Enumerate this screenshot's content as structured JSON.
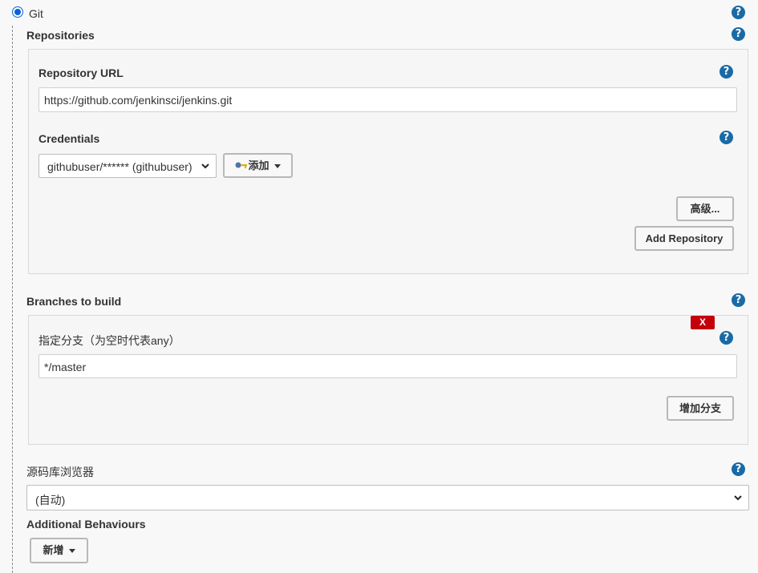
{
  "scm": {
    "git_label": "Git",
    "selected": true
  },
  "repositories": {
    "section_label": "Repositories",
    "url_label": "Repository URL",
    "url_value": "https://github.com/jenkinsci/jenkins.git",
    "credentials_label": "Credentials",
    "credentials_value": "githubuser/****** (githubuser)",
    "add_label": "添加",
    "advanced_label": "高级...",
    "add_repository_label": "Add Repository"
  },
  "branches": {
    "section_label": "Branches to build",
    "delete_label": "X",
    "specifier_label": "指定分支（为空时代表any）",
    "specifier_value": "*/master",
    "add_branch_label": "增加分支"
  },
  "browser": {
    "label": "源码库浏览器",
    "value": "(自动)"
  },
  "behaviours": {
    "label": "Additional Behaviours",
    "add_label": "新增"
  },
  "help_glyph": "?",
  "colors": {
    "help": "#1a6aa6",
    "delete": "#c4000a",
    "radio": "#0b62d6"
  }
}
